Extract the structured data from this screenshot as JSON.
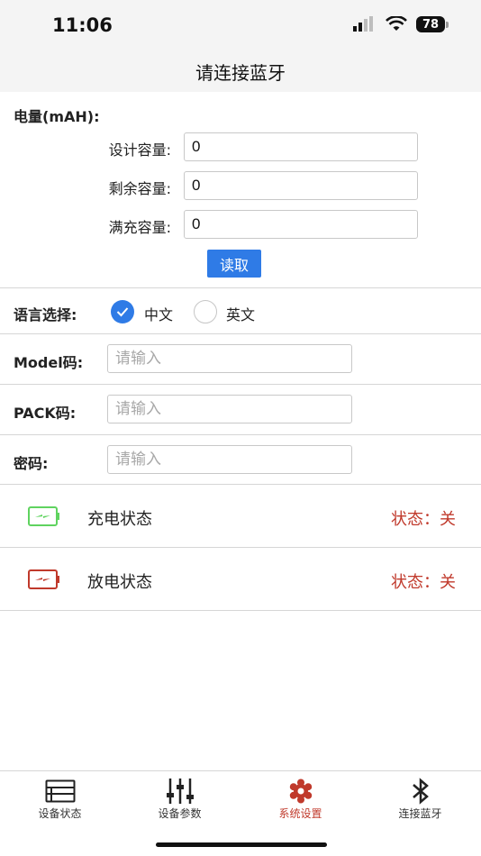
{
  "status_bar": {
    "time": "11:06",
    "battery": "78"
  },
  "nav": {
    "title": "请连接蓝牙"
  },
  "capacity": {
    "title": "电量(mAH):",
    "rows": [
      {
        "label": "设计容量:",
        "value": "0"
      },
      {
        "label": "剩余容量:",
        "value": "0"
      },
      {
        "label": "满充容量:",
        "value": "0"
      }
    ],
    "read_button": "读取"
  },
  "language": {
    "label": "语言选择:",
    "options": [
      {
        "label": "中文",
        "selected": true
      },
      {
        "label": "英文",
        "selected": false
      }
    ]
  },
  "fields": [
    {
      "label": "Model码:",
      "placeholder": "请输入",
      "value": ""
    },
    {
      "label": "PACK码:",
      "placeholder": "请输入",
      "value": ""
    },
    {
      "label": "密码:",
      "placeholder": "请输入",
      "value": ""
    }
  ],
  "states": [
    {
      "label": "充电状态",
      "value": "状态：关",
      "icon": "battery-charge-icon",
      "color": "#5fd35f"
    },
    {
      "label": "放电状态",
      "value": "状态：关",
      "icon": "battery-discharge-icon",
      "color": "#c0392b"
    }
  ],
  "tabs": [
    {
      "label": "设备状态",
      "icon": "list-icon",
      "active": false
    },
    {
      "label": "设备参数",
      "icon": "sliders-icon",
      "active": false
    },
    {
      "label": "系统设置",
      "icon": "gear-icon",
      "active": true
    },
    {
      "label": "连接蓝牙",
      "icon": "bluetooth-icon",
      "active": false
    }
  ],
  "colors": {
    "accent": "#2f7be6",
    "active_tab": "#c0392b",
    "charge": "#5fd35f",
    "discharge": "#c0392b"
  }
}
